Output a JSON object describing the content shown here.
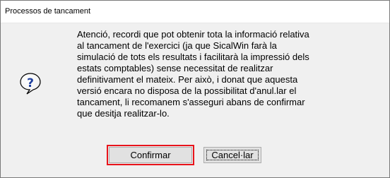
{
  "window": {
    "title": "Processos de tancament"
  },
  "message": {
    "lines": [
      "Atenció, recordi que pot obtenir tota la informació relativa",
      "al tancament de l'exercici (ja que SicalWin farà la",
      "simulació de tots els resultats i facilitarà la impressió dels",
      "estats comptables) sense necessitat de realitzar",
      "definitivament el mateix. Per això, i donat que aquesta",
      "versió encara no disposa de la possibilitat d'anul.lar el",
      "tancament, li recomanem s'asseguri abans de confirmar",
      "que desitja realitzar-lo."
    ]
  },
  "buttons": {
    "confirm_label": "Confirmar",
    "cancel_label": "Cancel·lar"
  },
  "icons": {
    "dialog_icon": "question-icon"
  },
  "colors": {
    "highlight": "#e8141b",
    "icon_fill": "#1e3f9e"
  }
}
